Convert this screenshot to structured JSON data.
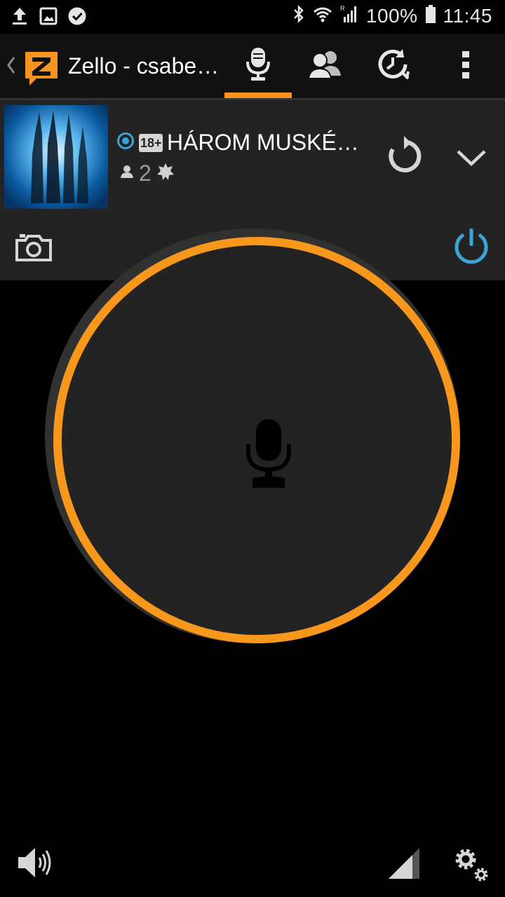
{
  "status_bar": {
    "battery": "100%",
    "time": "11:45",
    "left_icons": [
      "upload-icon",
      "image-icon",
      "check-circle-icon"
    ],
    "right_icons": [
      "bluetooth-icon",
      "wifi-icon",
      "signal-roaming-icon",
      "battery-icon"
    ]
  },
  "toolbar": {
    "title": "Zello - csabe…",
    "tabs": [
      {
        "icon": "microphone-icon",
        "active": true
      },
      {
        "icon": "contacts-icon",
        "active": false
      },
      {
        "icon": "history-icon",
        "active": false
      }
    ],
    "menu_icon": "more-vertical-icon",
    "accent_color": "#f7931e"
  },
  "channel": {
    "name": "HÁROM MUSKÉ…",
    "age_badge": "18+",
    "user_count": "2",
    "status_color": "#3ba3d8"
  },
  "ptt": {
    "ring_color": "#f7971c",
    "icon": "microphone-icon"
  },
  "bottom": {
    "icons": [
      "volume-icon",
      "signal-icon",
      "settings-icon"
    ]
  }
}
